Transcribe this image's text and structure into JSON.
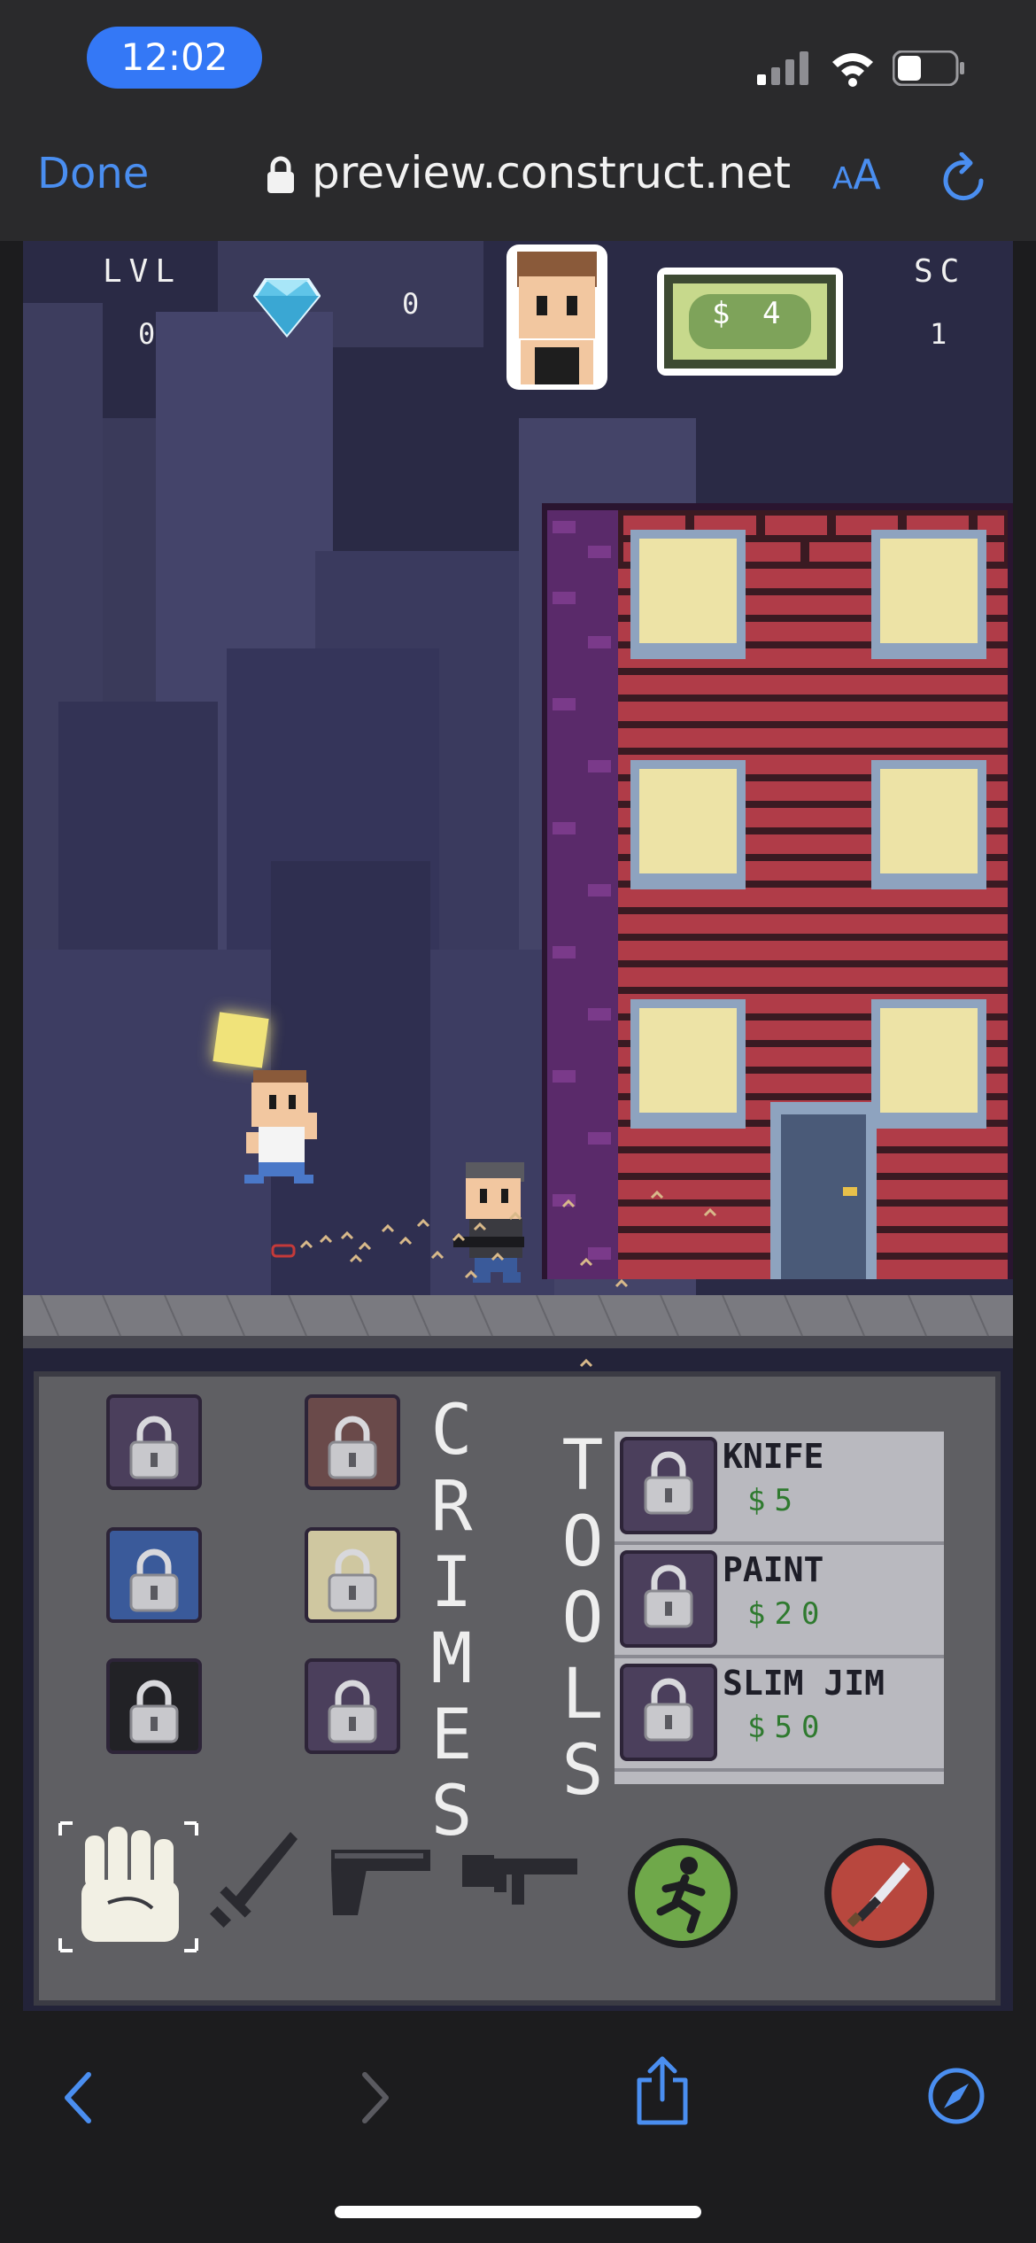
{
  "status": {
    "time": "12:02"
  },
  "browser": {
    "done_label": "Done",
    "url": "preview.construct.net",
    "aa_small": "A",
    "aa_big": "A"
  },
  "hud": {
    "level_label": "LVL",
    "level_value": "0",
    "gems_value": "0",
    "cash": "$ 4",
    "score_label": "SC",
    "score_value": "1"
  },
  "panel": {
    "crimes_letters": [
      "C",
      "R",
      "I",
      "M",
      "E",
      "S"
    ],
    "tools_letters": [
      "T",
      "O",
      "O",
      "L",
      "S"
    ],
    "shop_items": [
      {
        "name": "KNIFE",
        "price": "$5"
      },
      {
        "name": "PAINT",
        "price": "$20"
      },
      {
        "name": "SLIM JIM",
        "price": "$50"
      }
    ]
  },
  "weapons": [
    "fist-icon",
    "sword-icon",
    "pistol-icon",
    "rifle-icon",
    "run-button-icon",
    "attack-button-icon"
  ],
  "colors": {
    "accent_blue": "#3478f6",
    "brick": "#b03c48",
    "cash_green": "#7ea35a",
    "run_green": "#6fa84a",
    "attack_red": "#b8473e"
  }
}
